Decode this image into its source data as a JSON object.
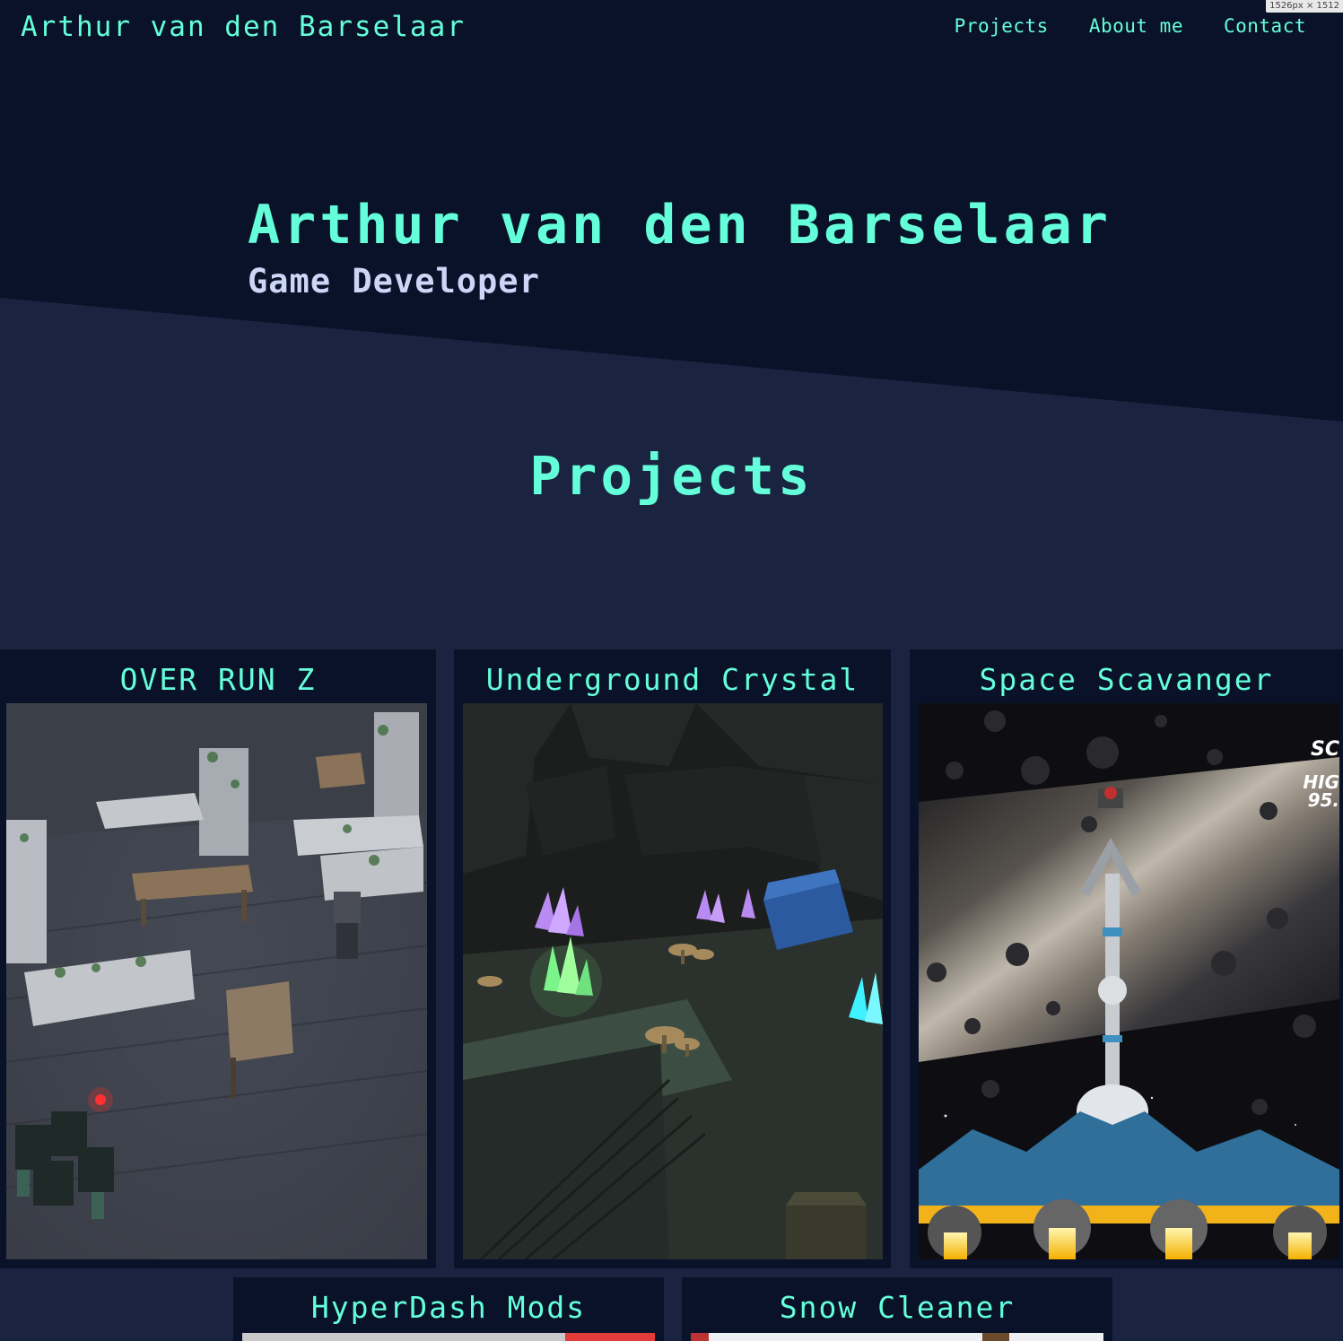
{
  "viewport_badge": "1526px × 1512",
  "header": {
    "logo": "Arthur van den Barselaar",
    "nav": [
      "Projects",
      "About me",
      "Contact"
    ]
  },
  "hero": {
    "title": "Arthur van den Barselaar",
    "subtitle": "Game Developer"
  },
  "projects": {
    "heading": "Projects",
    "items": [
      {
        "title": "OVER RUN Z",
        "image": "zombie-ruins-scene"
      },
      {
        "title": "Underground Crystal",
        "image": "crystal-cave-scene"
      },
      {
        "title": "Space Scavanger",
        "image": "spaceship-asteroids-scene",
        "overlay_text": [
          "SC",
          "HIG",
          "95."
        ]
      },
      {
        "title": "HyperDash Mods",
        "image": "hyperdash-thumbnail"
      },
      {
        "title": "Snow Cleaner",
        "image": "snow-cleaner-thumbnail"
      }
    ]
  },
  "colors": {
    "accent": "#64ffda",
    "navy_dark": "#0a1229",
    "navy": "#1a2440",
    "light_text": "#ccd6f6"
  }
}
